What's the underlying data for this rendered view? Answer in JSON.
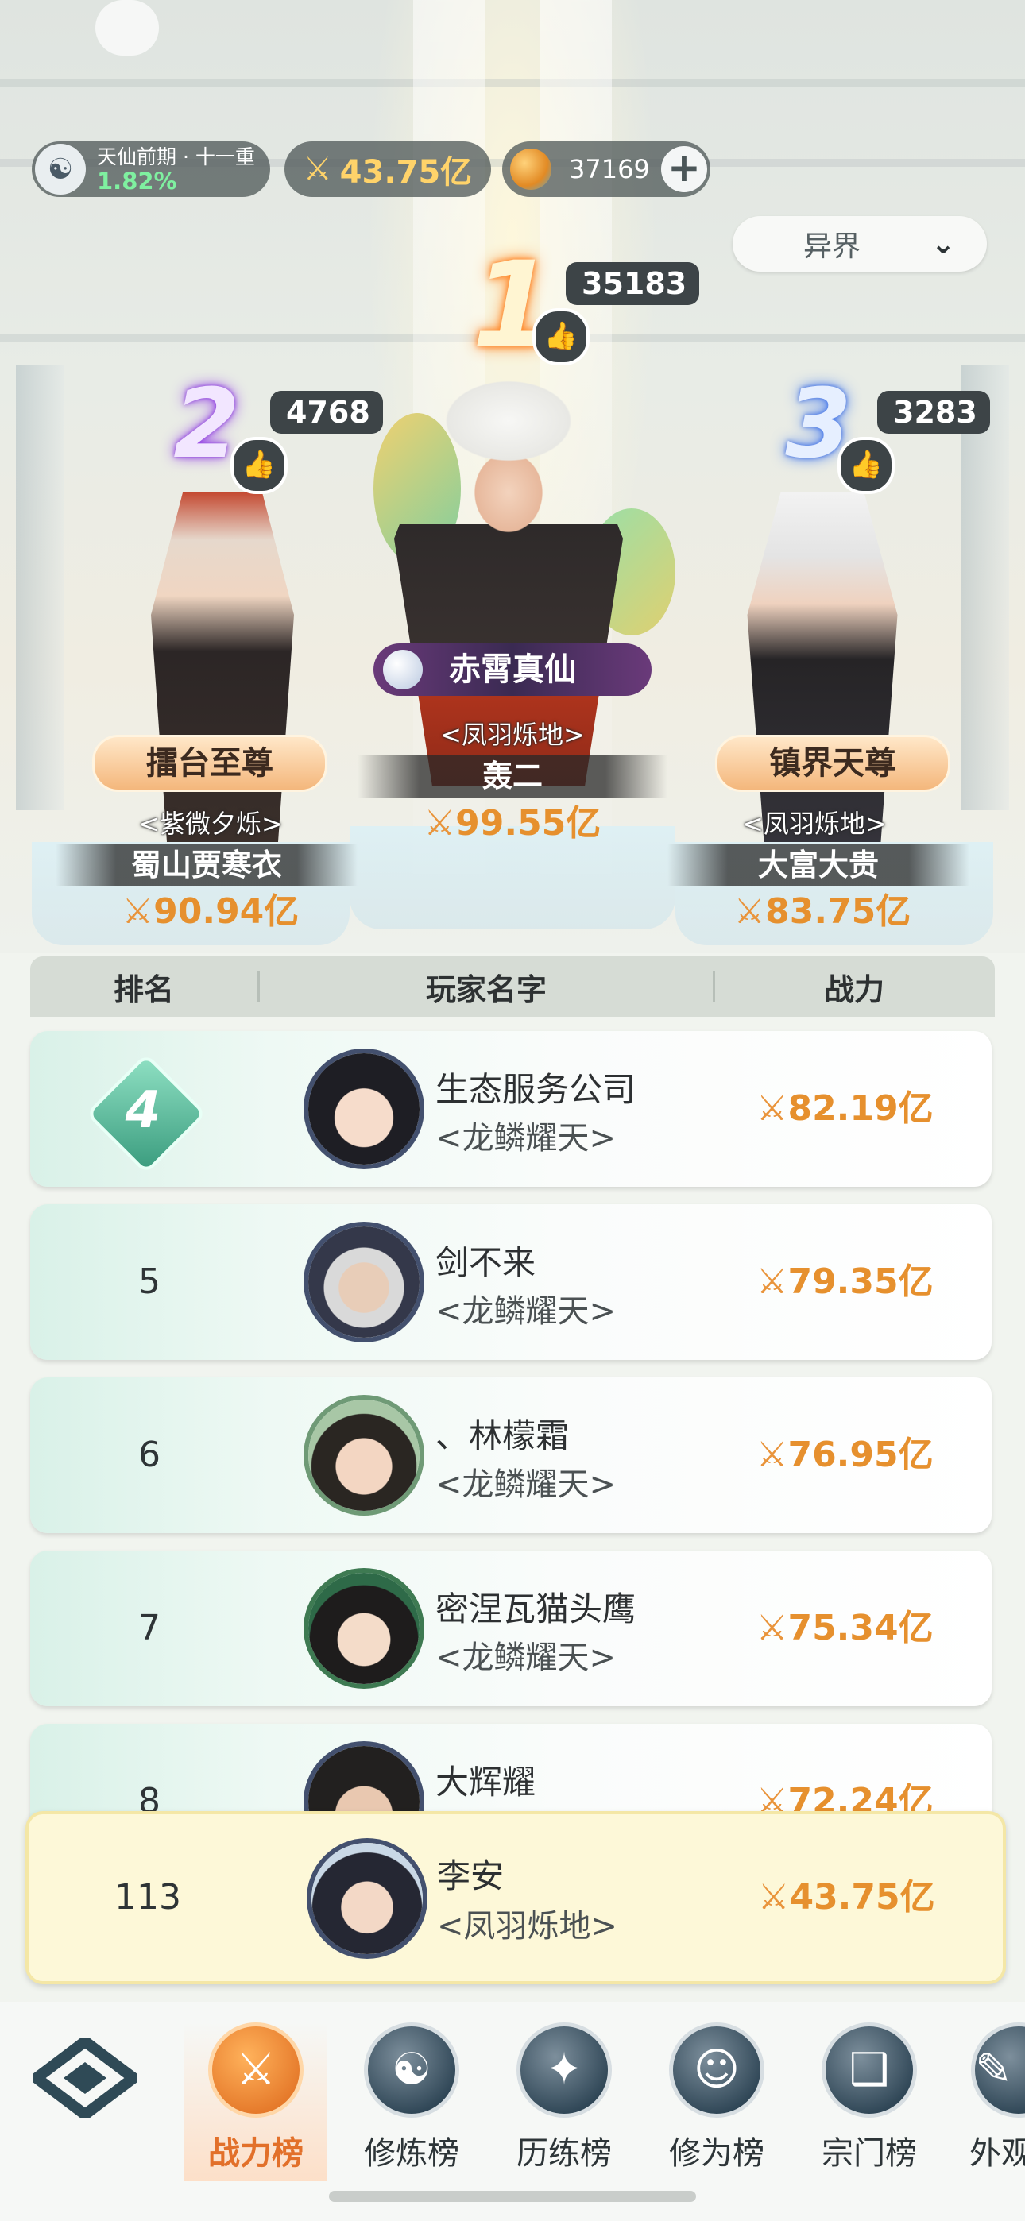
{
  "status": {
    "realm_text": "天仙前期 · 十一重",
    "realm_progress": "1.82%",
    "power": "43.75亿",
    "currency": "37169",
    "plus_icon": "plus-icon"
  },
  "world_select": {
    "value": "异界"
  },
  "podium": [
    {
      "rank": "1",
      "likes": "35183",
      "title": "赤霄真仙",
      "guild": "<凤羽烁地>",
      "name": "轰二",
      "power": "99.55亿"
    },
    {
      "rank": "2",
      "likes": "4768",
      "title": "擂台至尊",
      "guild": "<紫微夕烁>",
      "name": "蜀山贾寒衣",
      "power": "90.94亿"
    },
    {
      "rank": "3",
      "likes": "3283",
      "title": "镇界天尊",
      "guild": "<凤羽烁地>",
      "name": "大富大贵",
      "power": "83.75亿"
    }
  ],
  "table": {
    "headers": {
      "rank": "排名",
      "name": "玩家名字",
      "power": "战力"
    },
    "rows": [
      {
        "rank": "4",
        "name": "生态服务公司",
        "guild": "<龙鳞耀天>",
        "power": "82.19亿"
      },
      {
        "rank": "5",
        "name": "剑不来",
        "guild": "<龙鳞耀天>",
        "power": "79.35亿"
      },
      {
        "rank": "6",
        "name": "、林檬霜",
        "guild": "<龙鳞耀天>",
        "power": "76.95亿"
      },
      {
        "rank": "7",
        "name": "密涅瓦猫头鹰",
        "guild": "<龙鳞耀天>",
        "power": "75.34亿"
      },
      {
        "rank": "8",
        "name": "大辉耀",
        "guild": "",
        "power": "72.24亿"
      }
    ]
  },
  "me": {
    "rank": "113",
    "name": "李安",
    "guild": "<凤羽烁地>",
    "power": "43.75亿"
  },
  "sword_glyph": "⚔",
  "nav": {
    "tabs": [
      {
        "label": "战力榜",
        "icon": "crossed-swords-icon",
        "active": true
      },
      {
        "label": "修炼榜",
        "icon": "yin-yang-icon",
        "active": false
      },
      {
        "label": "历练榜",
        "icon": "star-compass-icon",
        "active": false
      },
      {
        "label": "修为榜",
        "icon": "sage-hat-icon",
        "active": false
      },
      {
        "label": "宗门榜",
        "icon": "scroll-book-icon",
        "active": false
      },
      {
        "label": "外观",
        "icon": "outfit-icon",
        "active": false
      }
    ]
  },
  "colors": {
    "power": "#e6902e",
    "active_tab": "#e2702a",
    "table_header": "#d6dcd5",
    "highlight_row": "#fdf8d8"
  }
}
